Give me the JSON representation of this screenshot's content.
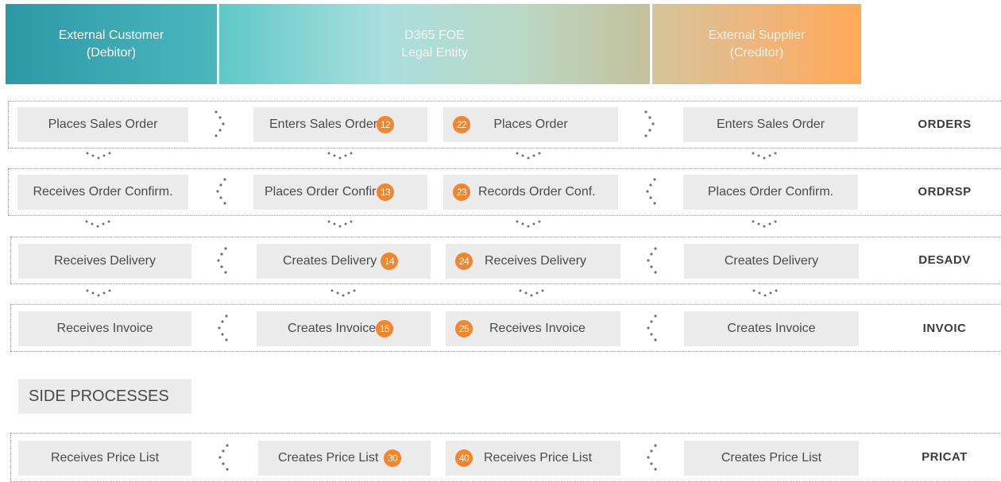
{
  "header": {
    "customer": {
      "line1": "External Customer",
      "line2": "(Debitor)"
    },
    "entity": {
      "line1": "D365 FOE",
      "line2": "Legal Entity"
    },
    "supplier": {
      "line1": "External Supplier",
      "line2": "(Creditor)"
    }
  },
  "rows": [
    {
      "customer": "Places Sales Order",
      "entity_customer": "Enters Sales Order",
      "entity_customer_step": "12",
      "entity_supplier": "Places Order",
      "entity_supplier_step": "22",
      "supplier": "Enters Sales Order",
      "message": "ORDERS"
    },
    {
      "customer": "Receives Order Confirm.",
      "entity_customer": "Places Order Confirm.",
      "entity_customer_step": "13",
      "entity_supplier": "Records Order Conf.",
      "entity_supplier_step": "23",
      "supplier": "Places Order Confirm.",
      "message": "ORDRSP"
    },
    {
      "customer": "Receives Delivery",
      "entity_customer": "Creates Delivery",
      "entity_customer_step": "14",
      "entity_supplier": "Receives Delivery",
      "entity_supplier_step": "24",
      "supplier": "Creates Delivery",
      "message": "DESADV"
    },
    {
      "customer": "Receives Invoice",
      "entity_customer": "Creates Invoice",
      "entity_customer_step": "15",
      "entity_supplier": "Receives Invoice",
      "entity_supplier_step": "25",
      "supplier": "Creates Invoice",
      "message": "INVOIC"
    }
  ],
  "side": {
    "title": "SIDE PROCESSES",
    "row": {
      "customer": "Receives Price List",
      "entity_customer": "Creates Price List",
      "entity_customer_step": "30",
      "entity_supplier": "Receives Price List",
      "entity_supplier_step": "40",
      "supplier": "Creates Price List",
      "message": "PRICAT"
    }
  },
  "colors": {
    "accent_badge": "#f4852b",
    "box_fill": "#ebebec",
    "teal": "#2b9aa6",
    "orange": "#ffaa56"
  }
}
